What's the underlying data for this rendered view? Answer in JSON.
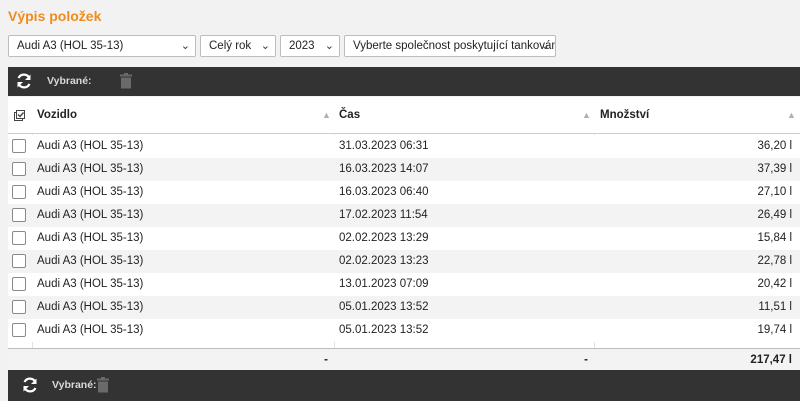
{
  "page": {
    "title": "Výpis položek"
  },
  "filters": {
    "vehicle": "Audi A3 (HOL 35-13)",
    "period": "Celý rok",
    "year": "2023",
    "company_placeholder": "Vyberte společnost poskytující tankování"
  },
  "toolbar": {
    "selected_label": "Vybrané:"
  },
  "table": {
    "columns": [
      "Vozidlo",
      "Čas",
      "Množství"
    ],
    "rows": [
      {
        "vehicle": "Audi A3 (HOL 35-13)",
        "time": "31.03.2023 06:31",
        "quantity": "36,20 l"
      },
      {
        "vehicle": "Audi A3 (HOL 35-13)",
        "time": "16.03.2023 14:07",
        "quantity": "37,39 l"
      },
      {
        "vehicle": "Audi A3 (HOL 35-13)",
        "time": "16.03.2023 06:40",
        "quantity": "27,10 l"
      },
      {
        "vehicle": "Audi A3 (HOL 35-13)",
        "time": "17.02.2023 11:54",
        "quantity": "26,49 l"
      },
      {
        "vehicle": "Audi A3 (HOL 35-13)",
        "time": "02.02.2023 13:29",
        "quantity": "15,84 l"
      },
      {
        "vehicle": "Audi A3 (HOL 35-13)",
        "time": "02.02.2023 13:23",
        "quantity": "22,78 l"
      },
      {
        "vehicle": "Audi A3 (HOL 35-13)",
        "time": "13.01.2023 07:09",
        "quantity": "20,42 l"
      },
      {
        "vehicle": "Audi A3 (HOL 35-13)",
        "time": "05.01.2023 13:52",
        "quantity": "11,51 l"
      },
      {
        "vehicle": "Audi A3 (HOL 35-13)",
        "time": "05.01.2023 13:52",
        "quantity": "19,74 l"
      }
    ],
    "footer": {
      "vehicle": "-",
      "time": "-",
      "quantity": "217,47 l"
    }
  },
  "icons": {
    "refresh": "refresh-icon",
    "trash": "trash-icon",
    "select_all": "select-all-icon",
    "sort": "sort-icon",
    "dropdown": "chevron-down-icon"
  },
  "colors": {
    "title": "#f08c1e",
    "toolbar_bg": "#333333",
    "row_alt": "#f3f3f3",
    "page_bg": "#f2f2f2"
  }
}
